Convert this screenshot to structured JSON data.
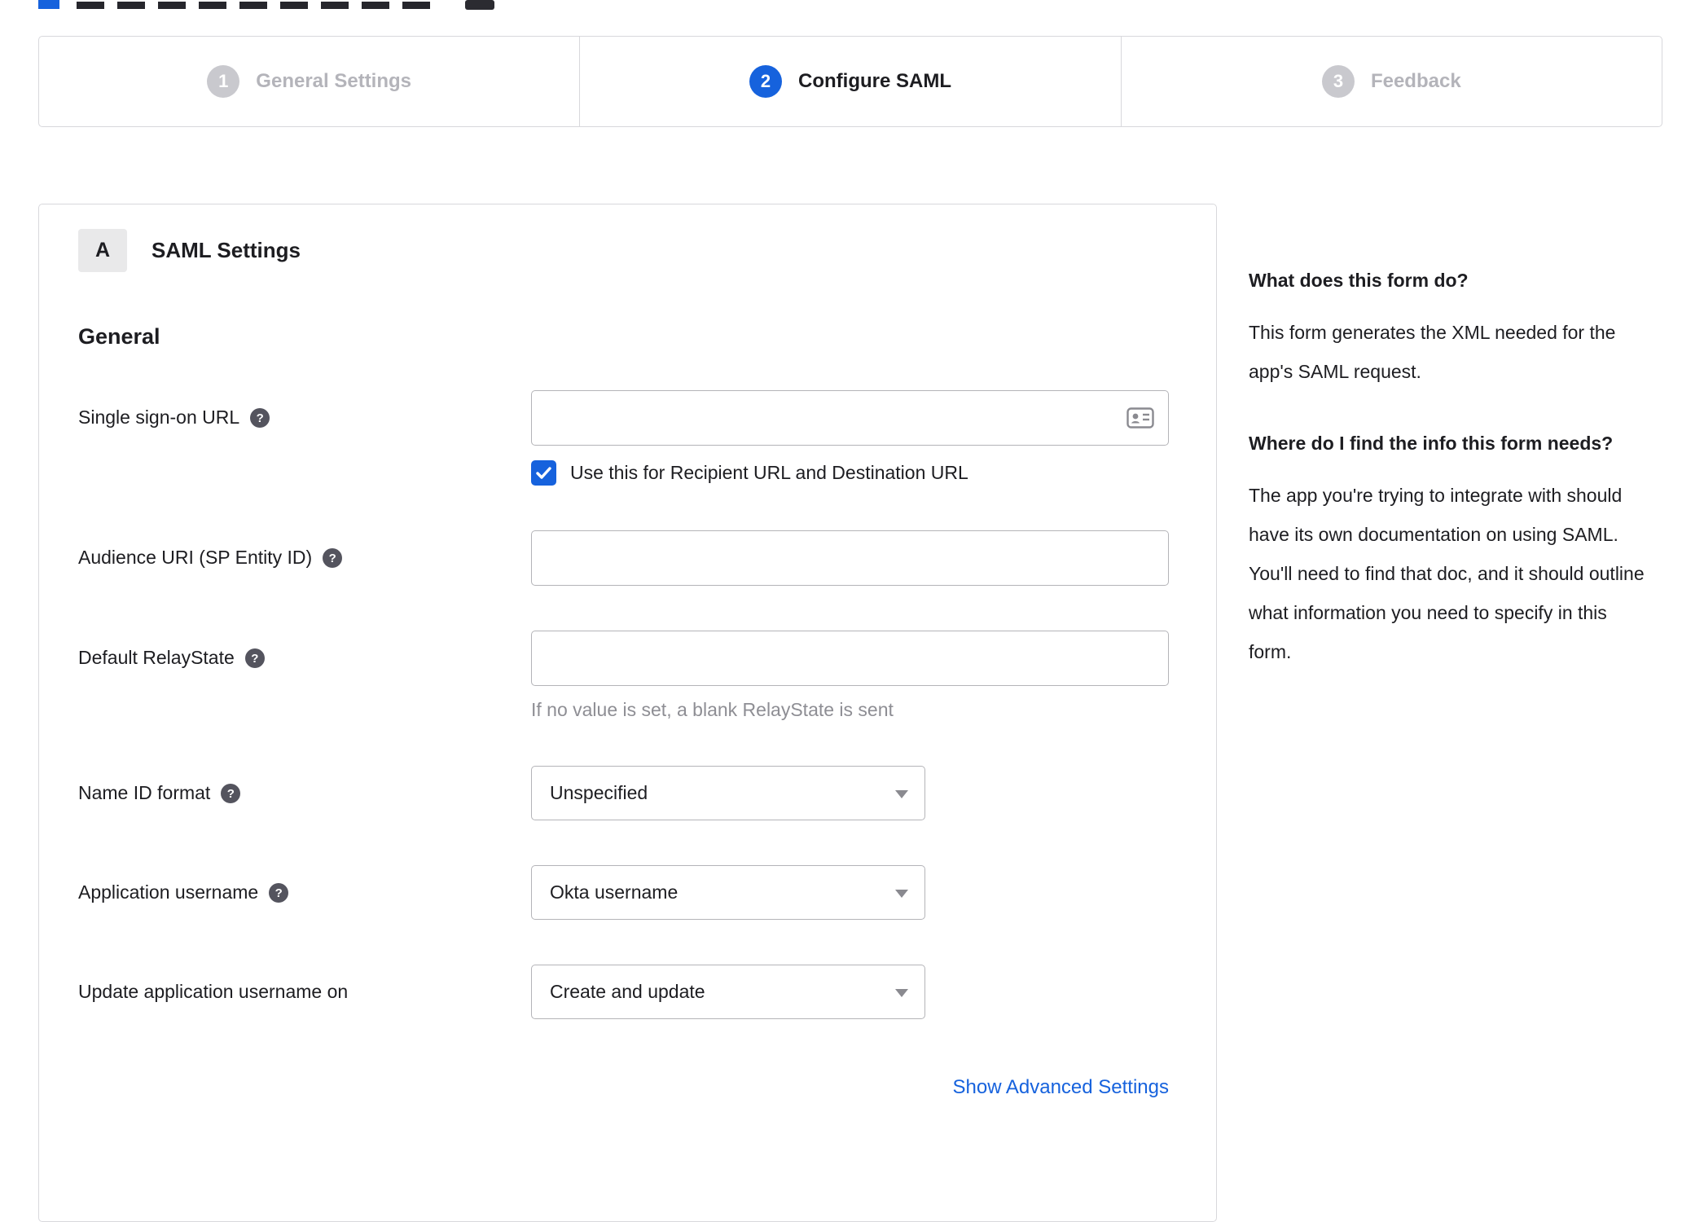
{
  "colors": {
    "accent_blue": "#1662dd",
    "inactive_gray": "#c9c9ce",
    "text_dark": "#1d1d21",
    "hint_gray": "#8e8e94"
  },
  "icons": {
    "help": "?",
    "dropdown_arrow": "dropdown-triangle",
    "checkmark": "check",
    "contact_card": "contact-card"
  },
  "stepper": {
    "steps": [
      {
        "number": "1",
        "label": "General Settings",
        "active": false
      },
      {
        "number": "2",
        "label": "Configure SAML",
        "active": true
      },
      {
        "number": "3",
        "label": "Feedback",
        "active": false
      }
    ]
  },
  "form": {
    "badge": "A",
    "title": "SAML Settings",
    "section": "General",
    "sso": {
      "label": "Single sign-on URL",
      "value": "",
      "checkbox_label": "Use this for Recipient URL and Destination URL",
      "checkbox_checked": true
    },
    "audience": {
      "label": "Audience URI (SP Entity ID)",
      "value": ""
    },
    "relay": {
      "label": "Default RelayState",
      "value": "",
      "hint": "If no value is set, a blank RelayState is sent"
    },
    "name_id": {
      "label": "Name ID format",
      "value": "Unspecified"
    },
    "app_username": {
      "label": "Application username",
      "value": "Okta username"
    },
    "update_username": {
      "label": "Update application username on",
      "value": "Create and update"
    },
    "advanced_link": "Show Advanced Settings"
  },
  "sidebar": {
    "q1": "What does this form do?",
    "a1": "This form generates the XML needed for the app's SAML request.",
    "q2": "Where do I find the info this form needs?",
    "a2": "The app you're trying to integrate with should have its own documentation on using SAML. You'll need to find that doc, and it should outline what information you need to specify in this form."
  }
}
